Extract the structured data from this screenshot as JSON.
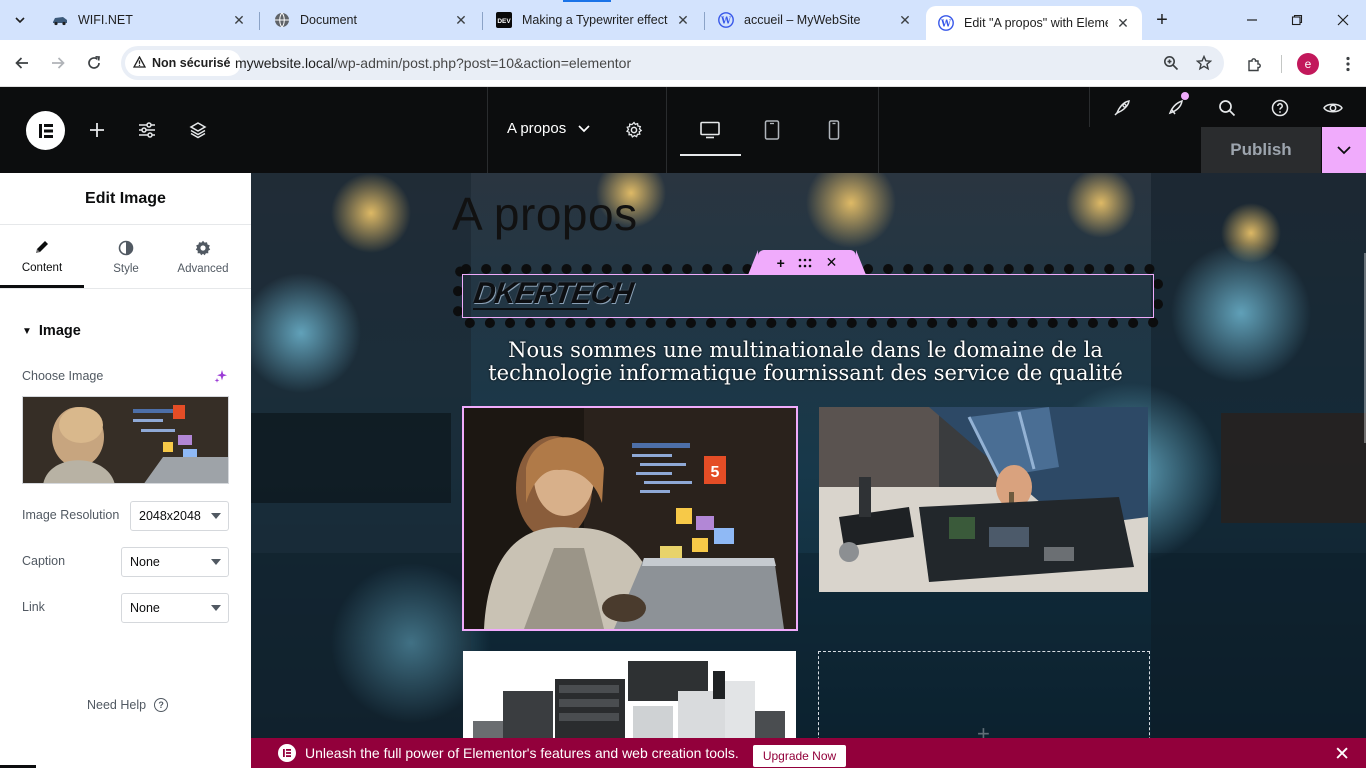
{
  "browser": {
    "tabs": [
      {
        "title": "WIFI.NET",
        "favicon": "car-icon",
        "active": false
      },
      {
        "title": "Document",
        "favicon": "globe-icon",
        "active": false
      },
      {
        "title": "Making a Typewriter effect fr",
        "favicon": "dev-icon",
        "active": false
      },
      {
        "title": "accueil – MyWebSite",
        "favicon": "wordpress-icon",
        "active": false
      },
      {
        "title": "Edit \"A propos\" with Elemen",
        "favicon": "wordpress-icon",
        "active": true
      }
    ],
    "security_label": "Non sécurisé",
    "url_host": "mywebsite.local",
    "url_path": "/wp-admin/post.php?post=10&action=elementor",
    "profile_initial": "e"
  },
  "elementor": {
    "page_name": "A propos",
    "publish_label": "Publish",
    "accent_color": "#f0abfc",
    "panel": {
      "title": "Edit Image",
      "tabs": [
        {
          "label": "Content",
          "icon": "pencil-icon",
          "active": true
        },
        {
          "label": "Style",
          "icon": "half-circle-icon",
          "active": false
        },
        {
          "label": "Advanced",
          "icon": "gear-icon",
          "active": false
        }
      ],
      "section_title": "Image",
      "choose_image_label": "Choose Image",
      "resolution_label": "Image Resolution",
      "resolution_value": "2048x2048",
      "caption_label": "Caption",
      "caption_value": "None",
      "link_label": "Link",
      "link_value": "None",
      "need_help": "Need Help"
    },
    "canvas": {
      "heading": "A propos",
      "logo_text": "DKERTECH",
      "lead_text": "Nous sommes une multinationale dans le domaine de la technologie informatique fournissant des service de qualité"
    },
    "promo": {
      "text": "Unleash the full power of Elementor's features and web creation tools.",
      "button": "Upgrade Now"
    }
  }
}
